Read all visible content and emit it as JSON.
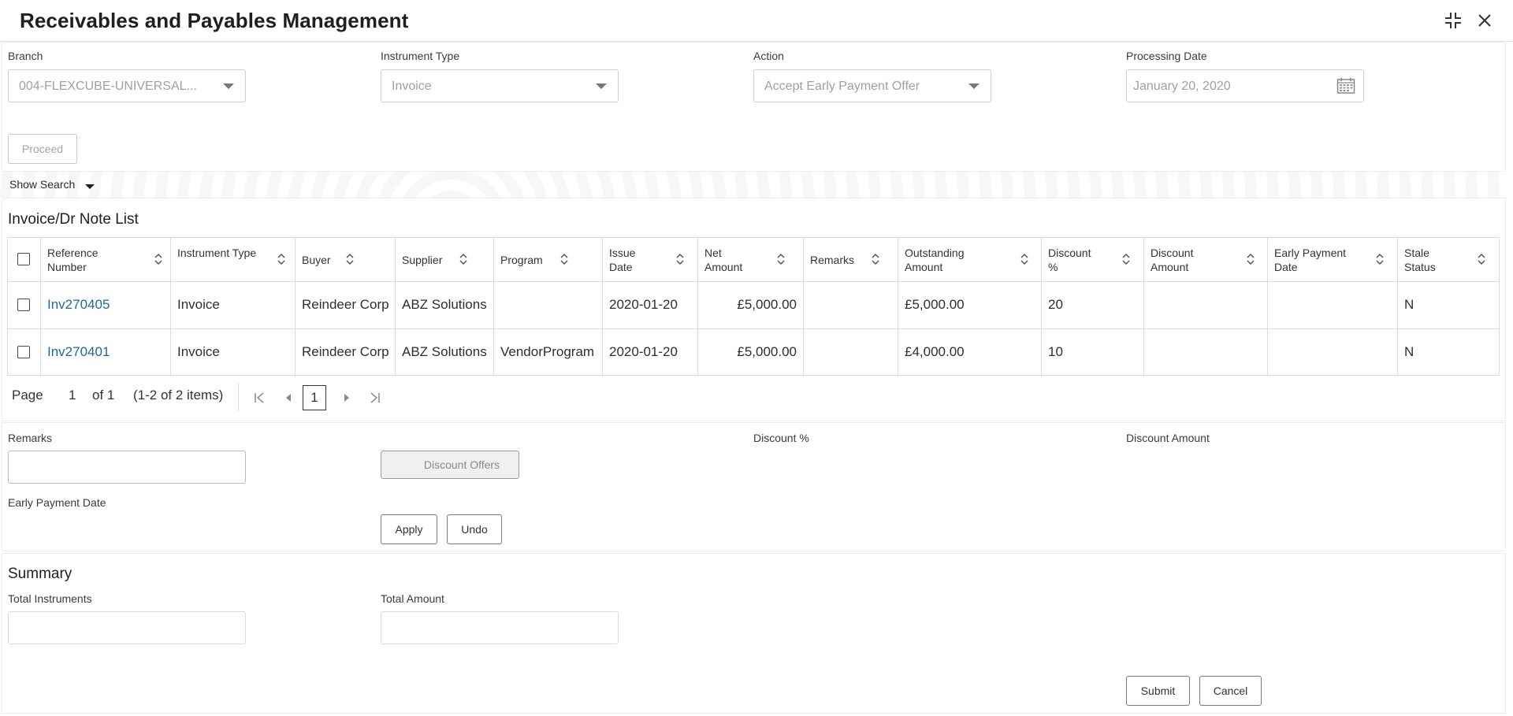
{
  "header": {
    "title": "Receivables and Payables Management"
  },
  "filters": {
    "branch": {
      "label": "Branch",
      "value": "004-FLEXCUBE-UNIVERSAL..."
    },
    "instrument_type": {
      "label": "Instrument Type",
      "value": "Invoice"
    },
    "action": {
      "label": "Action",
      "value": "Accept Early Payment Offer"
    },
    "processing_date": {
      "label": "Processing Date",
      "value": "January 20, 2020"
    },
    "proceed_label": "Proceed"
  },
  "show_search": "Show Search",
  "list": {
    "title": "Invoice/Dr Note List",
    "columns": [
      "Reference Number",
      "Instrument Type",
      "Buyer",
      "Supplier",
      "Program",
      "Issue Date",
      "Net Amount",
      "Remarks",
      "Outstanding Amount",
      "Discount %",
      "Discount Amount",
      "Early Payment Date",
      "Stale Status"
    ],
    "rows": [
      {
        "ref": "Inv270405",
        "type": "Invoice",
        "buyer": "Reindeer Corp",
        "supplier": "ABZ Solutions",
        "program": "",
        "issue_date": "2020-01-20",
        "net_amount": "£5,000.00",
        "remarks": "",
        "outstanding": "£5,000.00",
        "discount_pct": "20",
        "discount_amount": "",
        "early_date": "",
        "stale": "N"
      },
      {
        "ref": "Inv270401",
        "type": "Invoice",
        "buyer": "Reindeer Corp",
        "supplier": "ABZ Solutions",
        "program": "VendorProgram",
        "issue_date": "2020-01-20",
        "net_amount": "£5,000.00",
        "remarks": "",
        "outstanding": "£4,000.00",
        "discount_pct": "10",
        "discount_amount": "",
        "early_date": "",
        "stale": "N"
      }
    ],
    "pager": {
      "page_label": "Page",
      "page": "1",
      "of": "of 1",
      "items": "(1-2 of 2 items)",
      "current": "1"
    }
  },
  "discount": {
    "remarks_label": "Remarks",
    "discount_offers_label": "Discount Offers",
    "discount_pct_label": "Discount %",
    "discount_amount_label": "Discount Amount",
    "early_payment_date_label": "Early Payment Date",
    "apply_label": "Apply",
    "undo_label": "Undo"
  },
  "summary": {
    "title": "Summary",
    "total_instruments_label": "Total Instruments",
    "total_amount_label": "Total Amount",
    "submit_label": "Submit",
    "cancel_label": "Cancel"
  },
  "colors": {
    "link": "#1e6a9a",
    "border": "#dcdcdc"
  }
}
